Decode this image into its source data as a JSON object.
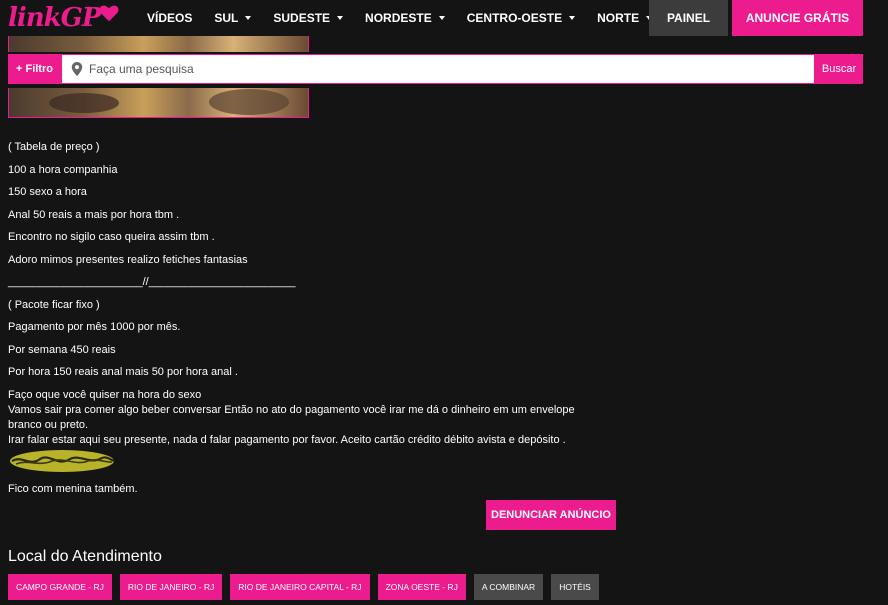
{
  "header": {
    "logo_text": "linkGP",
    "nav": [
      {
        "label": "VÍDEOS",
        "dropdown": false
      },
      {
        "label": "SUL",
        "dropdown": true
      },
      {
        "label": "SUDESTE",
        "dropdown": true
      },
      {
        "label": "NORDESTE",
        "dropdown": true
      },
      {
        "label": "CENTRO-OESTE",
        "dropdown": true
      },
      {
        "label": "NORTE",
        "dropdown": true
      }
    ],
    "painel_label": "PAINEL",
    "anuncie_label": "ANUNCIE GRÁTIS"
  },
  "search": {
    "filter_label": "+ Filtro",
    "placeholder": "Faça uma pesquisa",
    "value": "",
    "button_label": "Buscar"
  },
  "description": {
    "lines": [
      "( Tabela de preço )",
      "100 a hora companhia",
      "150 sexo a hora",
      "Anal 50 reais a mais por hora tbm .",
      "Encontro no sigilo caso queira assim tbm .",
      "Adoro mimos presentes realizo fetiches fantasias",
      "______________________//________________________",
      "( Pacote ficar fixo )",
      "Pagamento por mês 1000 por mês.",
      "Por semana 450 reais",
      "Por hora 150 reais anal mais 50 por hora anal ."
    ],
    "paragraph": [
      "Faço oque você quiser na hora do sexo",
      "Vamos sair pra comer algo beber conversar Então no ato do pagamento você irar me dá o dinheiro em um envelope branco ou preto.",
      "Irar falar estar aqui seu presente, nada d falar pagamento por favor. Aceito cartão crédito débito avista e depósito ."
    ],
    "closing": "Fico com menina também."
  },
  "report_label": "DENUNCIAR ANÚNCIO",
  "location": {
    "title": "Local do Atendimento",
    "tags": [
      {
        "label": "CAMPO GRANDE - RJ",
        "style": "pink"
      },
      {
        "label": "RIO DE JANEIRO - RJ",
        "style": "pink"
      },
      {
        "label": "RIO DE JANEIRO CAPITAL - RJ",
        "style": "pink"
      },
      {
        "label": "ZONA OESTE - RJ",
        "style": "pink"
      },
      {
        "label": "A COMBINAR",
        "style": "gray"
      },
      {
        "label": "HOTÉIS",
        "style": "gray"
      }
    ]
  },
  "colors": {
    "accent": "#ec1c8e",
    "background": "#141414",
    "secondary": "#4a4a4a"
  }
}
